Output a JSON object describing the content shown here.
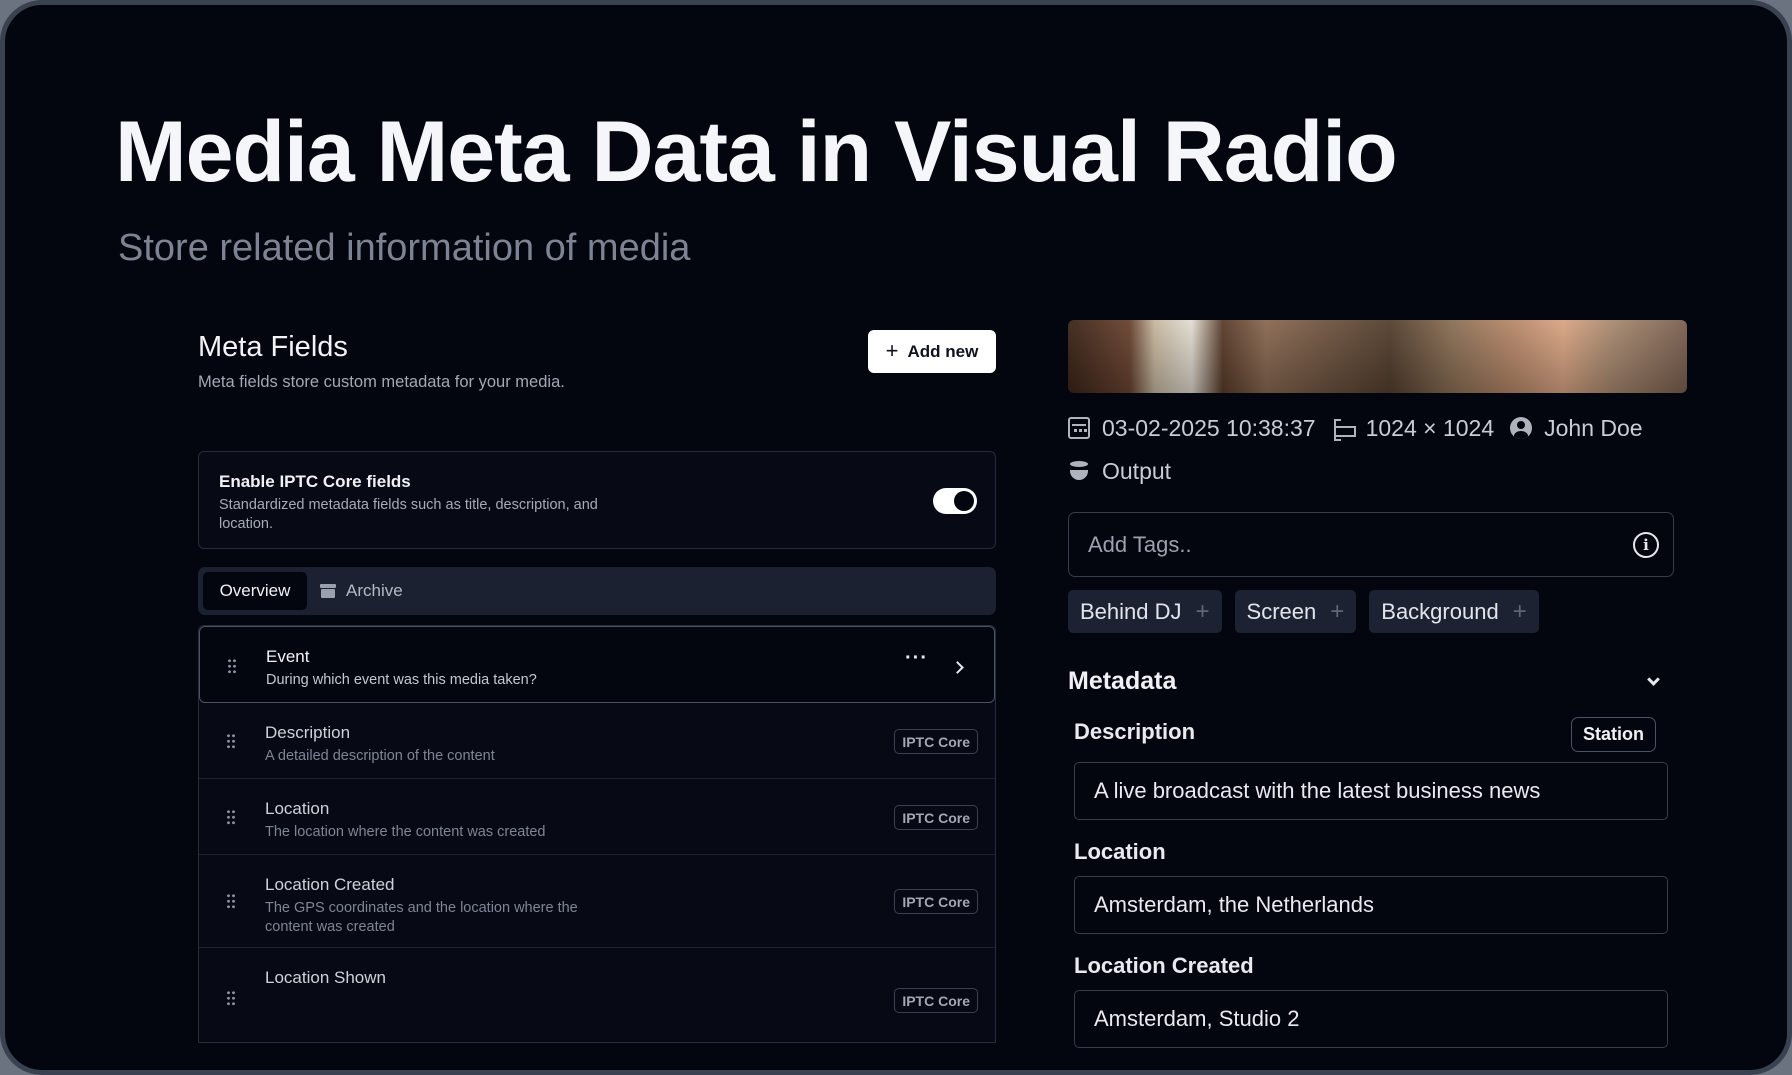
{
  "page": {
    "title": "Media Meta Data in Visual Radio",
    "subtitle": "Store related information of media"
  },
  "meta_fields": {
    "title": "Meta Fields",
    "description": "Meta fields store custom metadata for your media.",
    "add_new_label": "Add new",
    "iptc": {
      "title": "Enable IPTC Core fields",
      "description": "Standardized metadata fields such as title, description, and location.",
      "enabled": true
    },
    "tabs": [
      {
        "label": "Overview",
        "active": true,
        "icon": ""
      },
      {
        "label": "Archive",
        "active": false,
        "icon": "archive-icon"
      }
    ],
    "fields": [
      {
        "title": "Event",
        "description": "During which event was this media taken?",
        "badge": "",
        "active": true
      },
      {
        "title": "Description",
        "description": "A detailed description of the content",
        "badge": "IPTC Core",
        "active": false
      },
      {
        "title": "Location",
        "description": "The location where the content was created",
        "badge": "IPTC Core",
        "active": false
      },
      {
        "title": "Location Created",
        "description": "The GPS coordinates and the location where the content was created",
        "badge": "IPTC Core",
        "active": false
      },
      {
        "title": "Location Shown",
        "description": "",
        "badge": "IPTC Core",
        "active": false
      }
    ]
  },
  "media": {
    "date": "03-02-2025 10:38:37",
    "dimensions": "1024 × 1024",
    "author": "John Doe",
    "storage": "Output",
    "tags_placeholder": "Add Tags..",
    "tags": [
      "Behind DJ",
      "Screen",
      "Background"
    ],
    "tag_add_symbol": "+"
  },
  "metadata": {
    "title": "Metadata",
    "station_label": "Station",
    "fields": [
      {
        "label": "Description",
        "value": "A live broadcast with the latest business news"
      },
      {
        "label": "Location",
        "value": "Amsterdam, the Netherlands"
      },
      {
        "label": "Location Created",
        "value": "Amsterdam, Studio 2"
      }
    ]
  },
  "colors": {
    "background": "#04060f",
    "frame": "#3a4252",
    "accent_white": "#ffffff",
    "chip": "#1c2232"
  }
}
